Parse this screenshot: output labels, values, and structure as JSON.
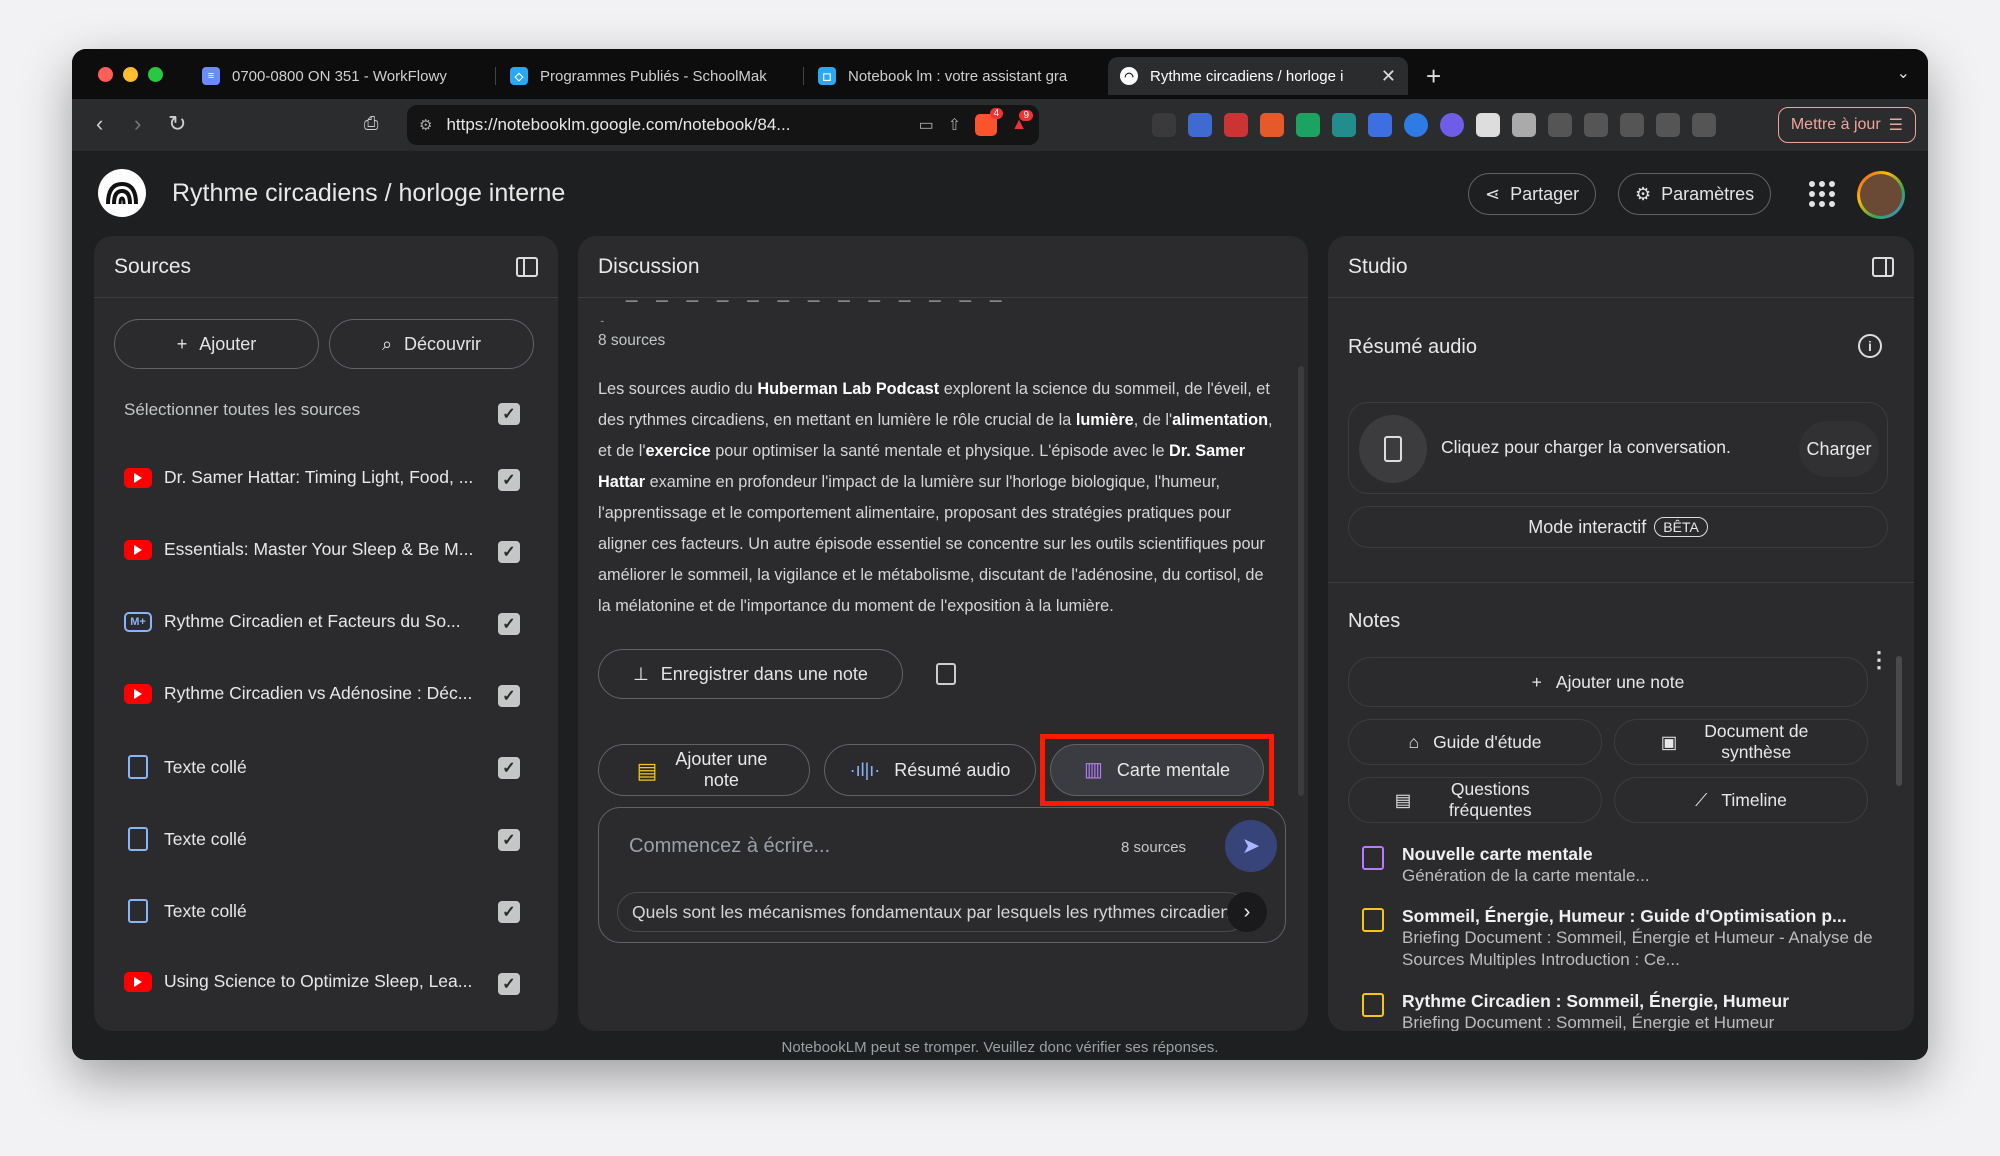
{
  "browser": {
    "tabs": [
      {
        "title": "0700-0800 ON 351 - WorkFlowy",
        "fav_color": "#6b8cff"
      },
      {
        "title": "Programmes Publiés - SchoolMak",
        "fav_color": "#2aa7f5"
      },
      {
        "title": "Notebook lm : votre assistant gra",
        "fav_color": "#2aa7f5"
      },
      {
        "title": "Rythme circadiens / horloge i",
        "fav_color": "#ffffff"
      }
    ],
    "url": "https://notebooklm.google.com/notebook/84...",
    "brave_badge": "4",
    "alert_badge": "9",
    "update_label": "Mettre à jour"
  },
  "app": {
    "title": "Rythme circadiens / horloge interne",
    "share_label": "Partager",
    "settings_label": "Paramètres"
  },
  "sources": {
    "heading": "Sources",
    "add_label": "Ajouter",
    "discover_label": "Découvrir",
    "select_all": "Sélectionner toutes les sources",
    "items": [
      {
        "label": "Dr. Samer Hattar: Timing Light, Food, ...",
        "type": "youtube"
      },
      {
        "label": "Essentials: Master Your Sleep & Be M...",
        "type": "youtube"
      },
      {
        "label": "Rythme Circadien et Facteurs du So...",
        "type": "markdown"
      },
      {
        "label": "Rythme Circadien vs Adénosine : Déc...",
        "type": "youtube"
      },
      {
        "label": "Texte collé",
        "type": "text"
      },
      {
        "label": "Texte collé",
        "type": "text"
      },
      {
        "label": "Texte collé",
        "type": "text"
      },
      {
        "label": "Using Science to Optimize Sleep, Lea...",
        "type": "youtube"
      }
    ]
  },
  "discussion": {
    "heading": "Discussion",
    "sources_count": "8 sources",
    "summary_parts": [
      "Les sources audio du ",
      "Huberman Lab Podcast",
      " explorent la science du sommeil, de l'éveil, et des rythmes circadiens, en mettant en lumière le rôle crucial de la ",
      "lumière",
      ", de l'",
      "alimentation",
      ", et de l'",
      "exercice",
      " pour optimiser la santé mentale et physique. L'épisode avec le ",
      "Dr. Samer Hattar",
      " examine en profondeur l'impact de la lumière sur l'horloge biologique, l'humeur, l'apprentissage et le comportement alimentaire, proposant des stratégies pratiques pour aligner ces facteurs. Un autre épisode essentiel se concentre sur les outils scientifiques pour améliorer le sommeil, la vigilance et le métabolisme, discutant de l'adénosine, du cortisol, de la mélatonine et de l'importance du moment de l'exposition à la lumière."
    ],
    "save_note_label": "Enregistrer dans une note",
    "add_note_label": "Ajouter une note",
    "audio_summary_label": "Résumé audio",
    "mindmap_label": "Carte mentale",
    "input_placeholder": "Commencez à écrire...",
    "input_sources": "8 sources",
    "suggestion": "Quels sont les mécanismes fondamentaux par lesquels les rythmes circadiens"
  },
  "studio": {
    "heading": "Studio",
    "audio_heading": "Résumé audio",
    "audio_prompt": "Cliquez pour charger la conversation.",
    "load_label": "Charger",
    "interactive_label": "Mode interactif",
    "beta_label": "BÊTA",
    "notes_heading": "Notes",
    "add_note_label": "Ajouter une note",
    "study_guide_label": "Guide d'étude",
    "briefing_label": "Document de synthèse",
    "faq_label": "Questions fréquentes",
    "timeline_label": "Timeline",
    "notes": [
      {
        "title": "Nouvelle carte mentale",
        "subtitle": "Génération de la carte mentale...",
        "type": "map"
      },
      {
        "title": "Sommeil, Énergie, Humeur : Guide d'Optimisation p...",
        "subtitle": "Briefing Document : Sommeil, Énergie et Humeur - Analyse de Sources Multiples Introduction : Ce...",
        "type": "doc"
      },
      {
        "title": "Rythme Circadien : Sommeil, Énergie, Humeur",
        "subtitle": "Briefing Document : Sommeil, Énergie et Humeur",
        "type": "doc"
      }
    ]
  },
  "footer": "NotebookLM peut se tromper. Veuillez donc vérifier ses réponses.",
  "colors": {
    "highlight": "#ff1a00",
    "accent": "#8ab4f8",
    "mindmap": "#b57cff"
  }
}
